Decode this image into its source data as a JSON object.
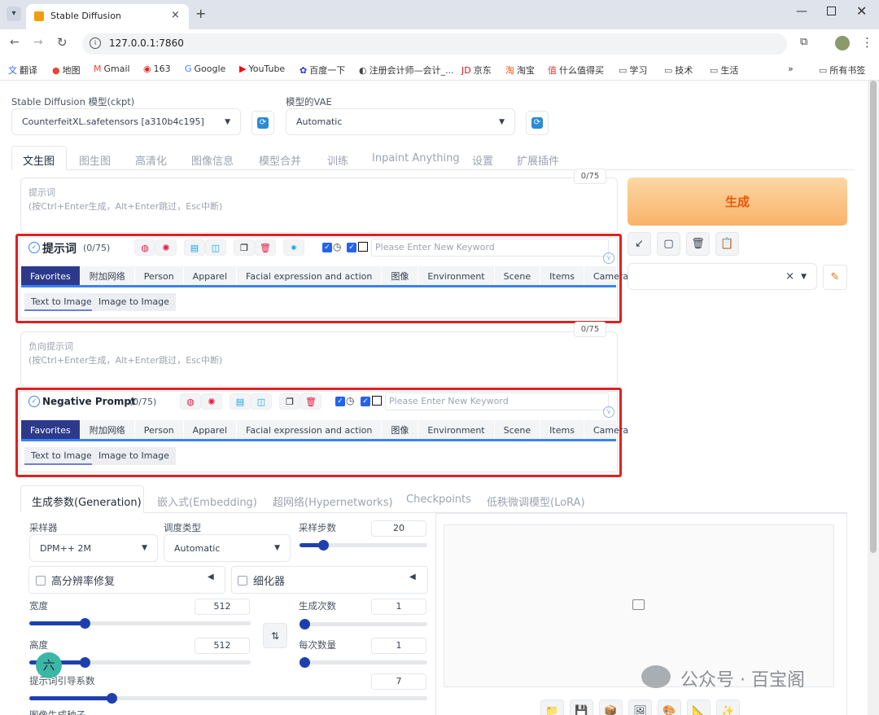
{
  "browser": {
    "tab_title": "Stable Diffusion",
    "url": "127.0.0.1:7860",
    "bookmarks": [
      "翻译",
      "地图",
      "Gmail",
      "163",
      "Google",
      "YouTube",
      "百度一下",
      "注册会计师—会计_...",
      "京东",
      "淘宝",
      "什么值得买",
      "学习",
      "技术",
      "生活"
    ],
    "all_bookmarks": "所有书签"
  },
  "top": {
    "ckpt_label": "Stable Diffusion 模型(ckpt)",
    "ckpt_value": "CounterfeitXL.safetensors [a310b4c195]",
    "vae_label": "模型的VAE",
    "vae_value": "Automatic"
  },
  "main_tabs": [
    "文生图",
    "图生图",
    "高清化",
    "图像信息",
    "模型合并",
    "训练",
    "Inpaint Anything",
    "设置",
    "扩展插件"
  ],
  "prompt": {
    "counter": "0/75",
    "placeholder_line1": "提示词",
    "placeholder_line2": "(按Ctrl+Enter生成，Alt+Enter跳过，Esc中断)",
    "panel_title": "提示词",
    "panel_count": "(0/75)",
    "keyword_placeholder": "Please Enter New Keyword"
  },
  "negative": {
    "counter": "0/75",
    "placeholder_line1": "负向提示词",
    "placeholder_line2": "(按Ctrl+Enter生成，Alt+Enter跳过，Esc中断)",
    "panel_title": "Negative Prompt",
    "panel_count": "(0/75)",
    "keyword_placeholder": "Please Enter New Keyword"
  },
  "categories": [
    "Favorites",
    "附加网络",
    "Person",
    "Apparel",
    "Facial expression and action",
    "图像",
    "Environment",
    "Scene",
    "Items",
    "Camera"
  ],
  "subtabs": [
    "Text to Image",
    "Image to Image"
  ],
  "generate_label": "生成",
  "param_tabs": [
    "生成参数(Generation)",
    "嵌入式(Embedding)",
    "超网络(Hypernetworks)",
    "Checkpoints",
    "低秩微调模型(LoRA)"
  ],
  "params": {
    "sampler_label": "采样器",
    "sampler_value": "DPM++ 2M",
    "schedule_label": "调度类型",
    "schedule_value": "Automatic",
    "steps_label": "采样步数",
    "steps_value": "20",
    "steps_fraction": 0.16,
    "hires_label": "高分辨率修复",
    "refiner_label": "细化器",
    "width_label": "宽度",
    "width_value": "512",
    "width_fraction": 0.24,
    "height_label": "高度",
    "height_value": "512",
    "height_fraction": 0.24,
    "batch_count_label": "生成次数",
    "batch_count_value": "1",
    "batch_count_fraction": 0.0,
    "batch_size_label": "每次数量",
    "batch_size_value": "1",
    "batch_size_fraction": 0.0,
    "cfg_label": "提示词引导系数",
    "cfg_value": "7",
    "cfg_fraction": 0.2,
    "seed_label": "图像生成种子"
  },
  "watermark": "公众号 · 百宝阁",
  "avatar_char": "六"
}
